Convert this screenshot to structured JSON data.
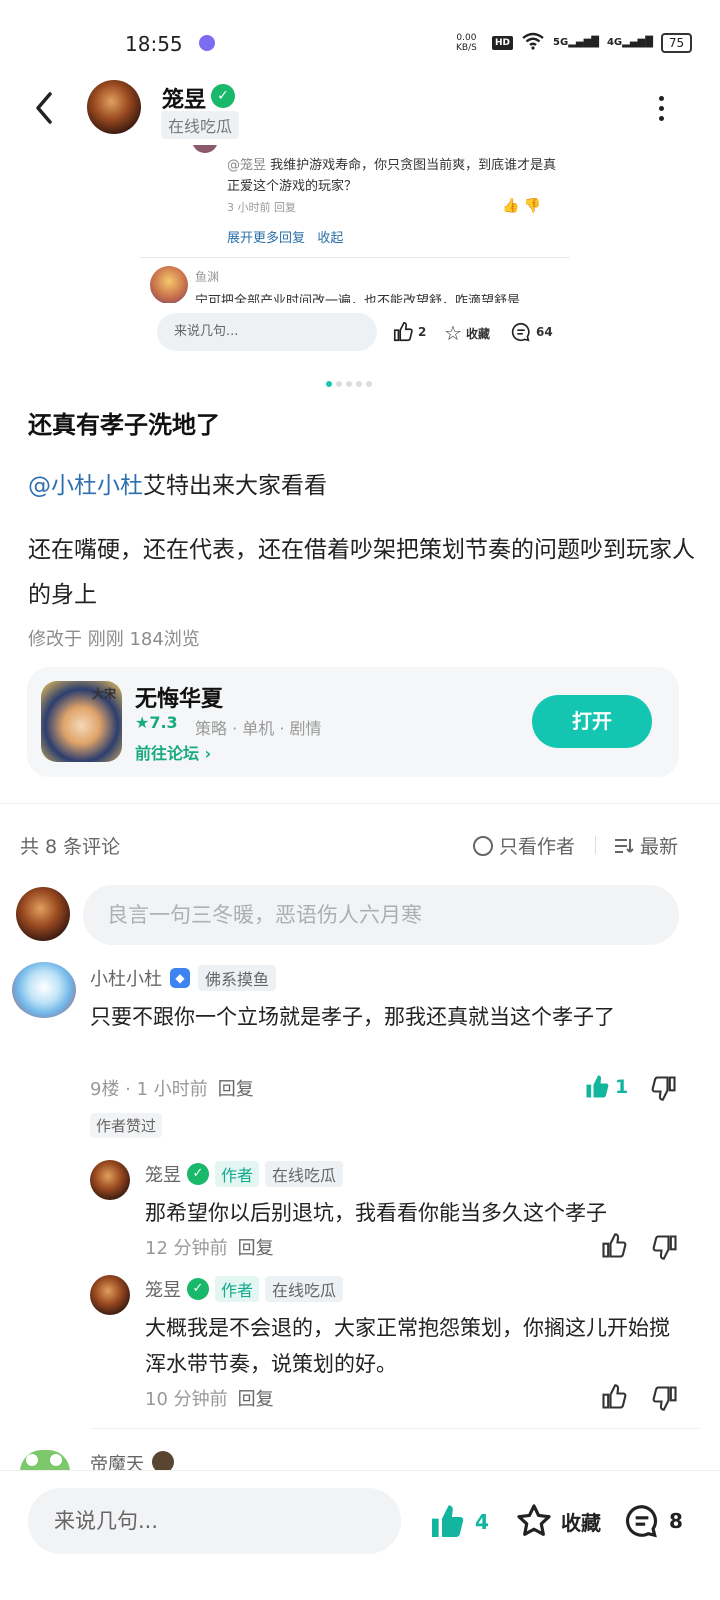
{
  "status_bar": {
    "time": "18:55",
    "net_speed_value": "0.00",
    "net_speed_unit": "KB/S",
    "hd": "HD",
    "signal_5g": "5G",
    "signal_4g": "4G",
    "battery": "75"
  },
  "header": {
    "author_name": "笼昱",
    "author_tag": "在线吃瓜"
  },
  "preview": {
    "comment_mention": "@笼昱",
    "comment_text": "我维护游戏寿命，你只贪图当前爽，到底谁才是真正爱这个游戏的玩家？",
    "comment_meta": "3 小时前  回复",
    "expand_more": "展开更多回复",
    "collapse": "收起",
    "second_name": "鱼渊",
    "second_text": "宁可把全部产业时间改一遍，也不能改望舒，咋滴望舒是",
    "input_placeholder": "来说几句...",
    "like_count": "2",
    "fav_label": "收藏",
    "comment_count": "64"
  },
  "post": {
    "title": "还真有孝子洗地了",
    "mention": "@小杜小杜",
    "mention_suffix": "艾特出来大家看看",
    "body": "还在嘴硬，还在代表，还在借着吵架把策划节奏的问题吵到玩家人的身上",
    "meta": "修改于 刚刚  184浏览"
  },
  "game_card": {
    "name": "无悔华夏",
    "rating": "7.3",
    "tags": "策略 · 单机 · 剧情",
    "forum_link": "前往论坛",
    "open_label": "打开",
    "icon_text": "大宋"
  },
  "comments_header": {
    "count": "共 8 条评论",
    "only_author": "只看作者",
    "sort": "最新"
  },
  "comment_input": {
    "placeholder": "良言一句三冬暖，恶语伤人六月寒"
  },
  "comments": [
    {
      "name": "小杜小杜",
      "tag": "佛系摸鱼",
      "text": "只要不跟你一个立场就是孝子，那我还真就当这个孝子了",
      "meta": "9楼 · 1 小时前",
      "reply": "回复",
      "likes": "1",
      "liked_by_author": "作者赞过"
    }
  ],
  "replies": [
    {
      "name": "笼昱",
      "author_label": "作者",
      "tag": "在线吃瓜",
      "text": "那希望你以后别退坑，我看看你能当多久这个孝子",
      "meta": "12 分钟前",
      "reply": "回复"
    },
    {
      "name": "笼昱",
      "author_label": "作者",
      "tag": "在线吃瓜",
      "text": "大概我是不会退的，大家正常抱怨策划，你搁这儿开始搅浑水带节奏，说策划的好。",
      "meta": "10 分钟前",
      "reply": "回复"
    }
  ],
  "next_comment": {
    "name": "帝魔天"
  },
  "bottom_bar": {
    "input_placeholder": "来说几句...",
    "like_count": "4",
    "fav_label": "收藏",
    "comment_count": "8"
  },
  "colors": {
    "accent": "#14c6b2",
    "link": "#2d6fb0",
    "verified": "#19b86a"
  }
}
